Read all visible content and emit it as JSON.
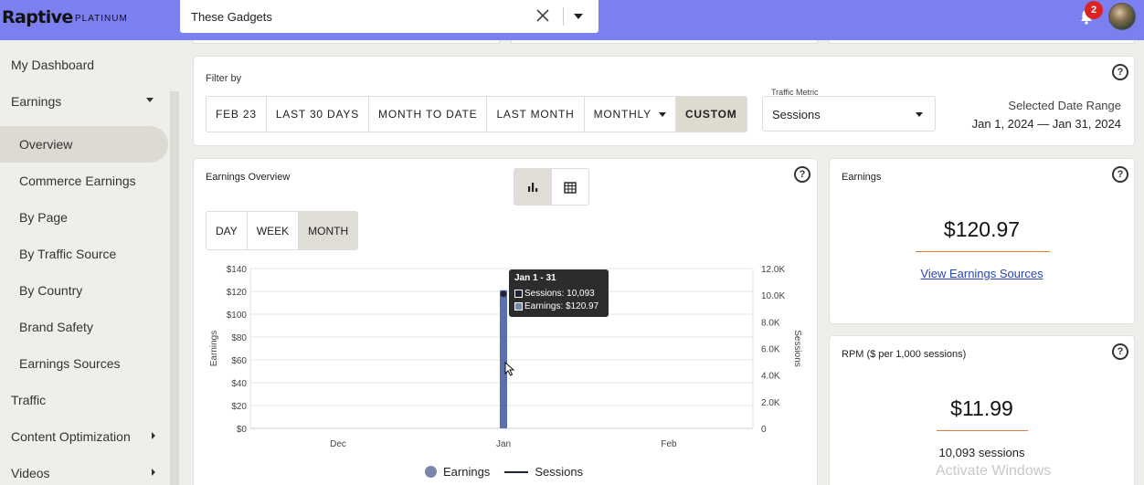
{
  "brand": {
    "name": "Raptive",
    "tier": "PLATINUM"
  },
  "site_select": {
    "value": "These Gadgets"
  },
  "notifications": {
    "count": "2"
  },
  "sidebar": {
    "items": [
      {
        "label": "My Dashboard"
      },
      {
        "label": "Earnings"
      },
      {
        "label": "Overview"
      },
      {
        "label": "Commerce Earnings"
      },
      {
        "label": "By Page"
      },
      {
        "label": "By Traffic Source"
      },
      {
        "label": "By Country"
      },
      {
        "label": "Brand Safety"
      },
      {
        "label": "Earnings Sources"
      },
      {
        "label": "Traffic"
      },
      {
        "label": "Content Optimization"
      },
      {
        "label": "Videos"
      }
    ]
  },
  "filter": {
    "title": "Filter by",
    "buttons": [
      "FEB 23",
      "LAST 30 DAYS",
      "MONTH TO DATE",
      "LAST MONTH",
      "MONTHLY",
      "CUSTOM"
    ],
    "selected": "CUSTOM",
    "traffic_metric_label": "Traffic Metric",
    "traffic_metric_value": "Sessions",
    "date_range_label": "Selected Date Range",
    "date_range_value": "Jan 1, 2024 — Jan 31, 2024"
  },
  "overview": {
    "title": "Earnings Overview",
    "granularity": [
      "DAY",
      "WEEK",
      "MONTH"
    ],
    "selected_granularity": "MONTH",
    "tooltip": {
      "title": "Jan 1 - 31",
      "sessions": "Sessions: 10,093",
      "earnings": "Earnings: $120.97"
    },
    "legend": {
      "earnings": "Earnings",
      "sessions": "Sessions"
    }
  },
  "chart_data": {
    "type": "bar",
    "categories": [
      "Dec",
      "Jan",
      "Feb"
    ],
    "series": [
      {
        "name": "Earnings",
        "type": "bar",
        "values": [
          0,
          120.97,
          0
        ],
        "axis": "left",
        "color": "#5b6fb0"
      },
      {
        "name": "Sessions",
        "type": "line",
        "values": [
          0,
          10093,
          0
        ],
        "axis": "right",
        "color": "#1d2433"
      }
    ],
    "ylabel": "Earnings",
    "ylabel_right": "Sessions",
    "ylim": [
      0,
      140
    ],
    "ylim_right": [
      0,
      12000
    ],
    "yticks": [
      "$0",
      "$20",
      "$40",
      "$60",
      "$80",
      "$100",
      "$120",
      "$140"
    ],
    "yticks_right": [
      "0",
      "2.0K",
      "4.0K",
      "6.0K",
      "8.0K",
      "10.0K",
      "12.0K"
    ],
    "grid": true,
    "legend": "bottom"
  },
  "earnings_card": {
    "title": "Earnings",
    "value": "$120.97",
    "link": "View Earnings Sources"
  },
  "rpm_card": {
    "title": "RPM ($ per 1,000 sessions)",
    "value": "$11.99",
    "sessions": "10,093 sessions"
  },
  "watermark": "Activate Windows",
  "colors": {
    "topbar": "#7b7ff0",
    "accent_underline": "#e07a3a",
    "bar": "#5b6fb0",
    "link": "#2a45b8"
  }
}
